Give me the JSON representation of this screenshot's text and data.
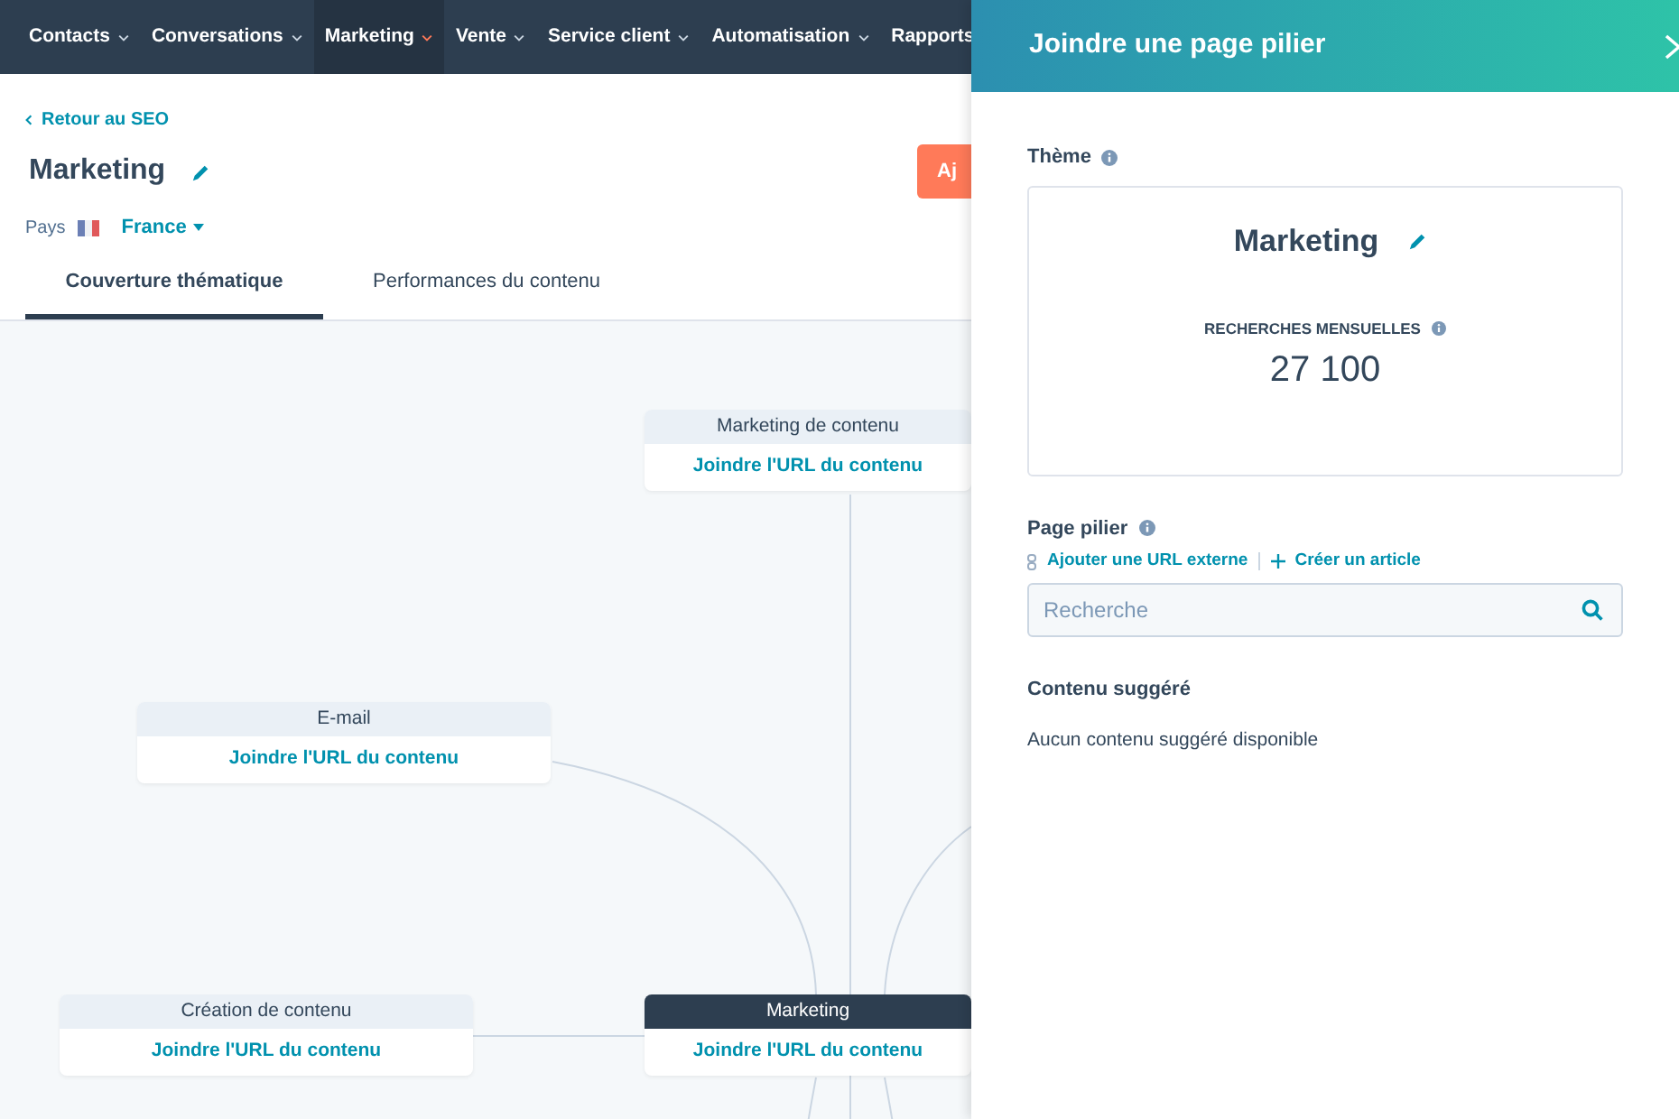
{
  "nav": {
    "items": [
      {
        "label": "Contacts",
        "selected": false
      },
      {
        "label": "Conversations",
        "selected": false
      },
      {
        "label": "Marketing",
        "selected": true
      },
      {
        "label": "Vente",
        "selected": false
      },
      {
        "label": "Service client",
        "selected": false
      },
      {
        "label": "Automatisation",
        "selected": false
      },
      {
        "label": "Rapports",
        "selected": false
      }
    ]
  },
  "header": {
    "back_link": "Retour au SEO",
    "title": "Marketing",
    "country_label": "Pays",
    "country": "France",
    "action_button": "Aj"
  },
  "tabs": [
    {
      "label": "Couverture thématique",
      "selected": true
    },
    {
      "label": "Performances du contenu",
      "selected": false
    }
  ],
  "map": {
    "nodes": [
      {
        "kind": "cluster",
        "title": "Marketing de contenu",
        "link": "Joindre l'URL du contenu"
      },
      {
        "kind": "cluster",
        "title": "E-mail",
        "link": "Joindre l'URL du contenu"
      },
      {
        "kind": "cluster",
        "title": "Création de contenu",
        "link": "Joindre l'URL du contenu"
      },
      {
        "kind": "pillar",
        "title": "Marketing",
        "link": "Joindre l'URL du contenu"
      }
    ]
  },
  "panel": {
    "title": "Joindre une page pilier",
    "theme": {
      "label": "Thème",
      "name": "Marketing",
      "metric_label": "RECHERCHES MENSUELLES",
      "metric_value": "27 100"
    },
    "pillar": {
      "label": "Page pilier",
      "actions": [
        "Ajouter une URL externe",
        "Créer un article"
      ],
      "search": {
        "placeholder": "Recherche"
      }
    },
    "suggested": {
      "label": "Contenu suggéré",
      "empty": "Aucun contenu suggéré disponible"
    }
  }
}
